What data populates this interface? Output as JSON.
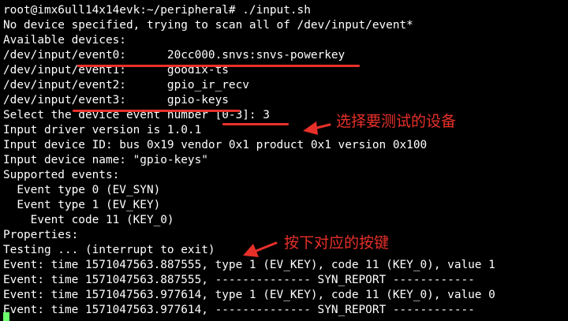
{
  "terminal": {
    "lines": [
      "root@imx6ull14x14evk:~/peripheral# ./input.sh",
      "No device specified, trying to scan all of /dev/input/event*",
      "Available devices:",
      "/dev/input/event0:      20cc000.snvs:snvs-powerkey",
      "/dev/input/event1:      goodix-ts",
      "/dev/input/event2:      gpio_ir_recv",
      "/dev/input/event3:      gpio-keys",
      "Select the device event number [0-3]: 3",
      "Input driver version is 1.0.1",
      "Input device ID: bus 0x19 vendor 0x1 product 0x1 version 0x100",
      "Input device name: \"gpio-keys\"",
      "Supported events:",
      "  Event type 0 (EV_SYN)",
      "  Event type 1 (EV_KEY)",
      "    Event code 11 (KEY_0)",
      "Properties:",
      "Testing ... (interrupt to exit)",
      "Event: time 1571047563.887555, type 1 (EV_KEY), code 11 (KEY_0), value 1",
      "Event: time 1571047563.887555, -------------- SYN_REPORT ------------",
      "Event: time 1571047563.977614, type 1 (EV_KEY), code 11 (KEY_0), value 0",
      "Event: time 1571047563.977614, -------------- SYN_REPORT ------------"
    ]
  },
  "annotations": {
    "select_device": "选择要测试的设备",
    "press_key": "按下对应的按键"
  },
  "colors": {
    "background": "#000000",
    "text": "#ffffff",
    "annotation": "#e8302a",
    "cursor": "#6aff6a"
  }
}
